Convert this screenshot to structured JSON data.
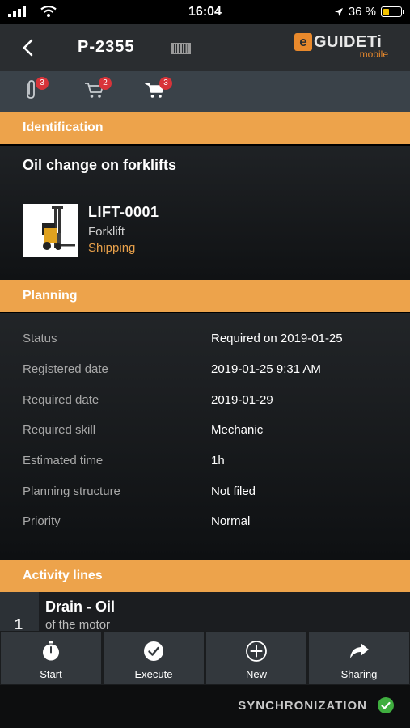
{
  "status_bar": {
    "time": "16:04",
    "battery_percent": "36 %"
  },
  "header": {
    "code": "P-2355",
    "logo": {
      "brand": "GUIDETi",
      "sub": "mobile"
    }
  },
  "toolbar": {
    "items": [
      {
        "icon": "paperclip-icon",
        "badge": "3"
      },
      {
        "icon": "cart-outline-icon",
        "badge": "2"
      },
      {
        "icon": "cart-filled-icon",
        "badge": "3"
      }
    ]
  },
  "identification": {
    "heading": "Identification",
    "task_title": "Oil change on forklifts",
    "asset": {
      "code": "LIFT-0001",
      "type": "Forklift",
      "department": "Shipping"
    }
  },
  "planning": {
    "heading": "Planning",
    "rows": [
      {
        "label": "Status",
        "value": "Required on 2019-01-25"
      },
      {
        "label": "Registered date",
        "value": "2019-01-25 9:31 AM"
      },
      {
        "label": "Required date",
        "value": "2019-01-29"
      },
      {
        "label": "Required skill",
        "value": "Mechanic"
      },
      {
        "label": "Estimated time",
        "value": "1h"
      },
      {
        "label": "Planning structure",
        "value": "Not filed"
      },
      {
        "label": "Priority",
        "value": "Normal"
      }
    ]
  },
  "activity": {
    "heading": "Activity lines",
    "items": [
      {
        "number": "1",
        "title": "Drain - Oil",
        "subtitle": "of the motor"
      }
    ]
  },
  "actions": {
    "start": "Start",
    "execute": "Execute",
    "new": "New",
    "sharing": "Sharing"
  },
  "sync": {
    "label": "SYNCHRONIZATION"
  },
  "colors": {
    "accent": "#eda34b",
    "badge": "#d8343a",
    "header": "#2a2d30",
    "toolbar": "#3a4249",
    "sync_ok": "#3fae3f"
  }
}
